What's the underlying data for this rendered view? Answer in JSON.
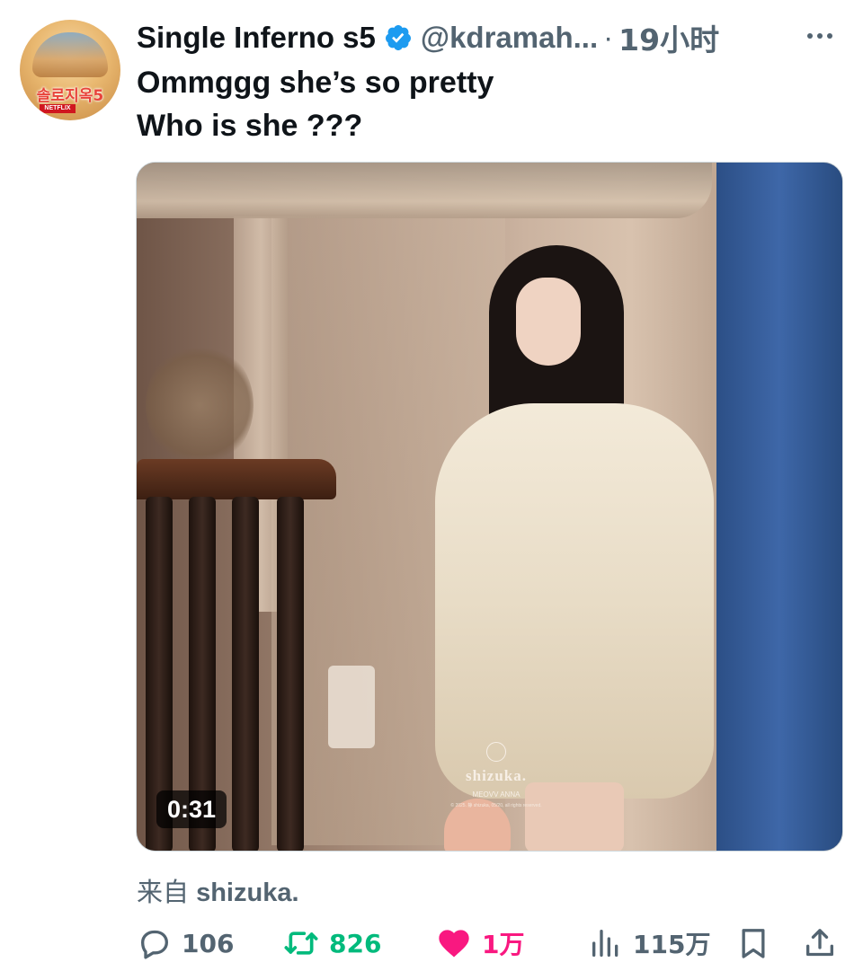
{
  "account": {
    "avatar_label": "솔로지옥5",
    "avatar_brand": "NETFLIX",
    "name": "Single Inferno s5",
    "handle": "@kdramah...",
    "separator": "·",
    "time": "19小时"
  },
  "tweet": {
    "lines": [
      "Ommggg she’s so pretty",
      "Who is she ???"
    ]
  },
  "media": {
    "duration": "0:31",
    "watermark": {
      "brand": "shizuka.",
      "subtitle": "MEOVV ANNA",
      "copyright": "© 2025. 静 shizuka, 05/20, all rights reserved."
    }
  },
  "source": {
    "prefix": "来自",
    "name": "shizuka."
  },
  "actions": {
    "replies": "106",
    "retweets": "826",
    "likes": "1万",
    "views": "115万"
  },
  "colors": {
    "verified": "#1d9bf0",
    "retweet_active": "#00ba7c",
    "like_active": "#f91880",
    "secondary_text": "#536471"
  },
  "icons": {
    "verified": "verified-badge-icon",
    "more": "more-dots-icon",
    "reply": "reply-bubble-icon",
    "retweet": "retweet-arrows-icon",
    "like": "heart-icon",
    "views": "bar-chart-icon",
    "bookmark": "bookmark-icon",
    "share": "share-upload-icon"
  }
}
